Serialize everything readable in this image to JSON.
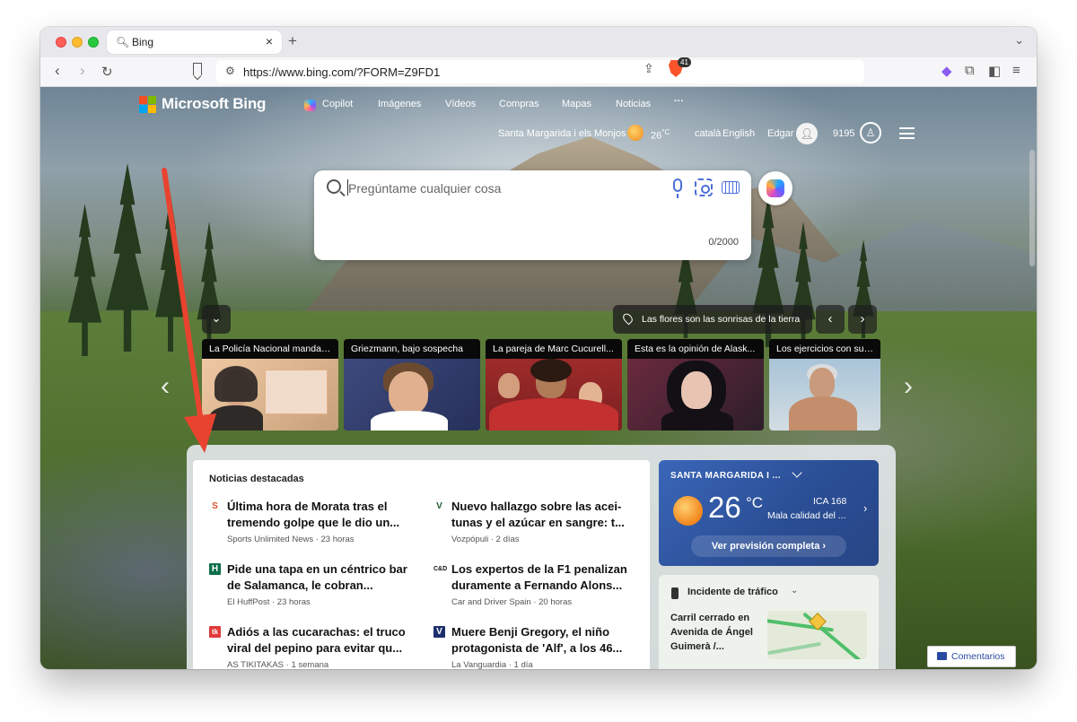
{
  "browser": {
    "tab_title": "Bing",
    "url": "https://www.bing.com/?FORM=Z9FD1",
    "brave_badge": "41",
    "new_tab": "+"
  },
  "header": {
    "logo_text": "Microsoft Bing",
    "logo_colors": [
      "#f25022",
      "#7fba00",
      "#00a4ef",
      "#ffb900"
    ],
    "nav": [
      "Copilot",
      "Imágenes",
      "Vídeos",
      "Compras",
      "Mapas",
      "Noticias",
      "···"
    ],
    "location": "Santa Margarida i els Monjos",
    "temperature": "26",
    "temp_unit": "°C",
    "lang_1": "català",
    "lang_2": "English",
    "user_name": "Edgar",
    "reward_points": "9195"
  },
  "search": {
    "placeholder": "Pregúntame cualquier cosa",
    "char_count": "0/2000"
  },
  "carousel": {
    "caption": "Las flores son las sonrisas de la tierra",
    "cards": [
      {
        "title": "La Policía Nacional manda ..."
      },
      {
        "title": "Griezmann, bajo sospecha"
      },
      {
        "title": "La pareja de Marc Cucurell..."
      },
      {
        "title": "Esta es la opinión de Alask..."
      },
      {
        "title": "Los ejercicios con su pro"
      }
    ]
  },
  "news": {
    "section_title": "Noticias destacadas",
    "items": [
      {
        "headline": "Última hora de Morata tras el tremendo golpe que le dio un...",
        "source": "Sports Unlimited News · 23 horas",
        "icon": "S",
        "icon_color": "#d9532b"
      },
      {
        "headline": "Nuevo hallazgo sobre las acei-tunas y el azúcar en sangre: t...",
        "source": "Vozpópuli · 2 días",
        "icon": "V",
        "icon_color": "#1d5e2e"
      },
      {
        "headline": "Pide una tapa en un céntrico bar de Salamanca, le cobran...",
        "source": "El HuffPost · 23 horas",
        "icon": "H",
        "icon_color": "#0c6f4a"
      },
      {
        "headline": "Los expertos de la F1 penalizan duramente a Fernando Alons...",
        "source": "Car and Driver Spain · 20 horas",
        "icon": "C&D",
        "icon_color": "#111111"
      },
      {
        "headline": "Adiós a las cucarachas: el truco viral del pepino para evitar qu...",
        "source": "AS TIKITAKAS · 1 semana",
        "icon": "tk",
        "icon_color": "#e03a3a"
      },
      {
        "headline": "Muere Benji Gregory, el niño protagonista de 'Alf', a los 46...",
        "source": "La Vanguardia · 1 día",
        "icon": "V",
        "icon_color": "#1e2f6e"
      }
    ]
  },
  "weather": {
    "location": "SANTA MARGARIDA I ...",
    "temperature": "26",
    "unit": "°C",
    "aqi": "ICA 168",
    "condition": "Mala calidad del ...",
    "cta": "Ver previsión completa"
  },
  "traffic": {
    "title": "Incidente de tráfico",
    "text": "Carril cerrado en Avenida de Ángel Guimerà /..."
  },
  "feedback": {
    "label": "Comentarios"
  },
  "colors": {
    "accent": "#4c6ed8",
    "arrow": "#e8432f"
  }
}
